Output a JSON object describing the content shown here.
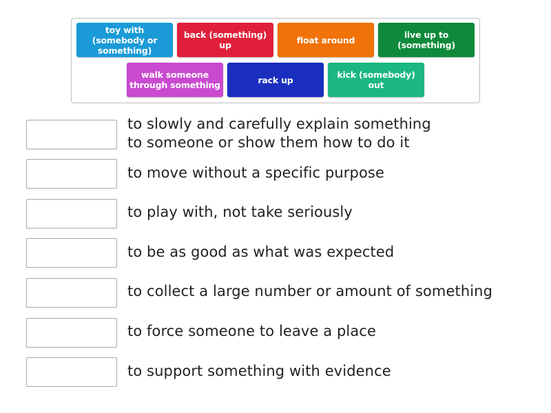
{
  "tiles": [
    {
      "label": "toy with (somebody or something)",
      "color": "#1a9bd8"
    },
    {
      "label": "back (something) up",
      "color": "#e0203a"
    },
    {
      "label": "float around",
      "color": "#f07208"
    },
    {
      "label": "live up to (something)",
      "color": "#0f8a3a"
    },
    {
      "label": "walk someone through something",
      "color": "#c94ad0"
    },
    {
      "label": "rack up",
      "color": "#1a2fbf"
    },
    {
      "label": "kick (somebody) out",
      "color": "#1bb783"
    }
  ],
  "definitions": [
    {
      "line1": "to slowly and carefully explain something",
      "line2": "to someone or show them how to do it"
    },
    {
      "line1": "to move without a specific purpose"
    },
    {
      "line1": "to play with, not take seriously"
    },
    {
      "line1": "to be as good as what was expected"
    },
    {
      "line1": "to collect a large number or amount of something"
    },
    {
      "line1": "to force someone to leave a place"
    },
    {
      "line1": "to support something with evidence"
    }
  ]
}
